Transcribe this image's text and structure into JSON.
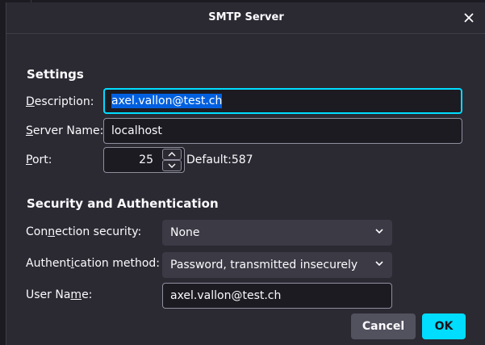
{
  "dialog": {
    "title": "SMTP Server"
  },
  "settings": {
    "heading": "Settings",
    "description_label_key": "D",
    "description_label_rest": "escription:",
    "description_value": "axel.vallon@test.ch",
    "server_name_label_key": "S",
    "server_name_label_rest": "erver Name:",
    "server_name_value": "localhost",
    "port_label_key": "P",
    "port_label_rest": "ort:",
    "port_value": "25",
    "port_default": "Default:587"
  },
  "security": {
    "heading": "Security and Authentication",
    "connection_label_pre": "Con",
    "connection_label_key": "n",
    "connection_label_post": "ection security:",
    "connection_value": "None",
    "auth_label_pre": "Authent",
    "auth_label_key": "i",
    "auth_label_post": "cation method:",
    "auth_value": "Password, transmitted insecurely",
    "username_label_pre": "User Na",
    "username_label_key": "m",
    "username_label_post": "e:",
    "username_value": "axel.vallon@test.ch"
  },
  "buttons": {
    "cancel": "Cancel",
    "ok": "OK"
  },
  "colors": {
    "dialog_bg": "#2b2a33",
    "focus_ring": "#00ddff",
    "selection": "#0060df",
    "ok_button": "#00ddff"
  },
  "icons": {
    "close": "close-icon",
    "spin_up": "chevron-up-icon",
    "spin_down": "chevron-down-icon",
    "select": "chevron-down-icon"
  }
}
